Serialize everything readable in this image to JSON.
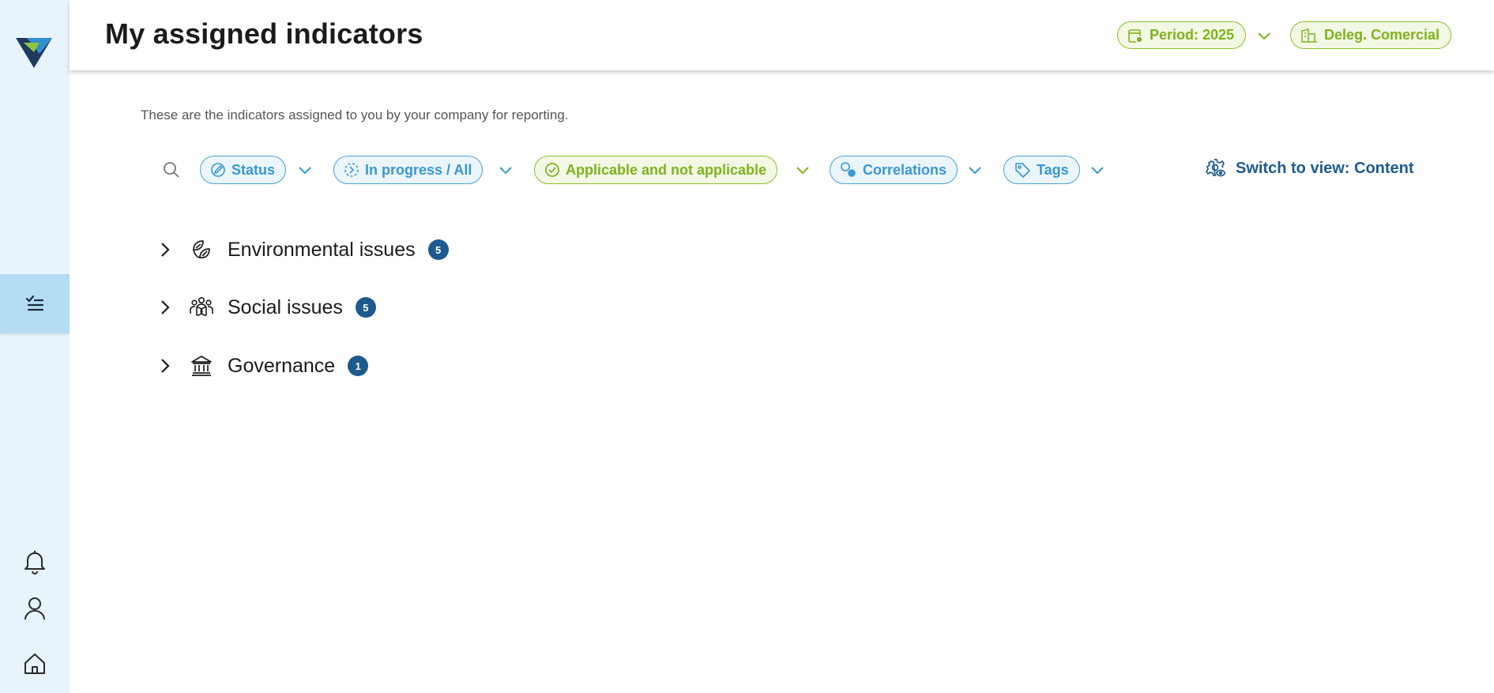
{
  "header": {
    "title": "My assigned indicators",
    "period_label": "Period: 2025",
    "entity_label": "Deleg. Comercial"
  },
  "subtitle": "These are the indicators assigned to you by your company for reporting.",
  "filters": {
    "status": "Status",
    "progress": "In progress / All",
    "applicability": "Applicable and not applicable",
    "correlations": "Correlations",
    "tags": "Tags"
  },
  "switch_view_label": "Switch to view: Content",
  "groups": [
    {
      "label": "Environmental issues",
      "count": "5",
      "icon": "leaves-icon"
    },
    {
      "label": "Social issues",
      "count": "5",
      "icon": "people-group-icon"
    },
    {
      "label": "Governance",
      "count": "1",
      "icon": "institution-icon"
    }
  ],
  "sidebar": {
    "items": [
      "checklist-icon",
      "bell-icon",
      "user-icon",
      "home-icon"
    ]
  },
  "colors": {
    "accent_blue": "#3a97d1",
    "accent_green": "#7fb21c",
    "brand_navy": "#1f5a8f",
    "sidebar_bg": "#e8f4fb",
    "sidebar_active": "#b3dcf3"
  }
}
